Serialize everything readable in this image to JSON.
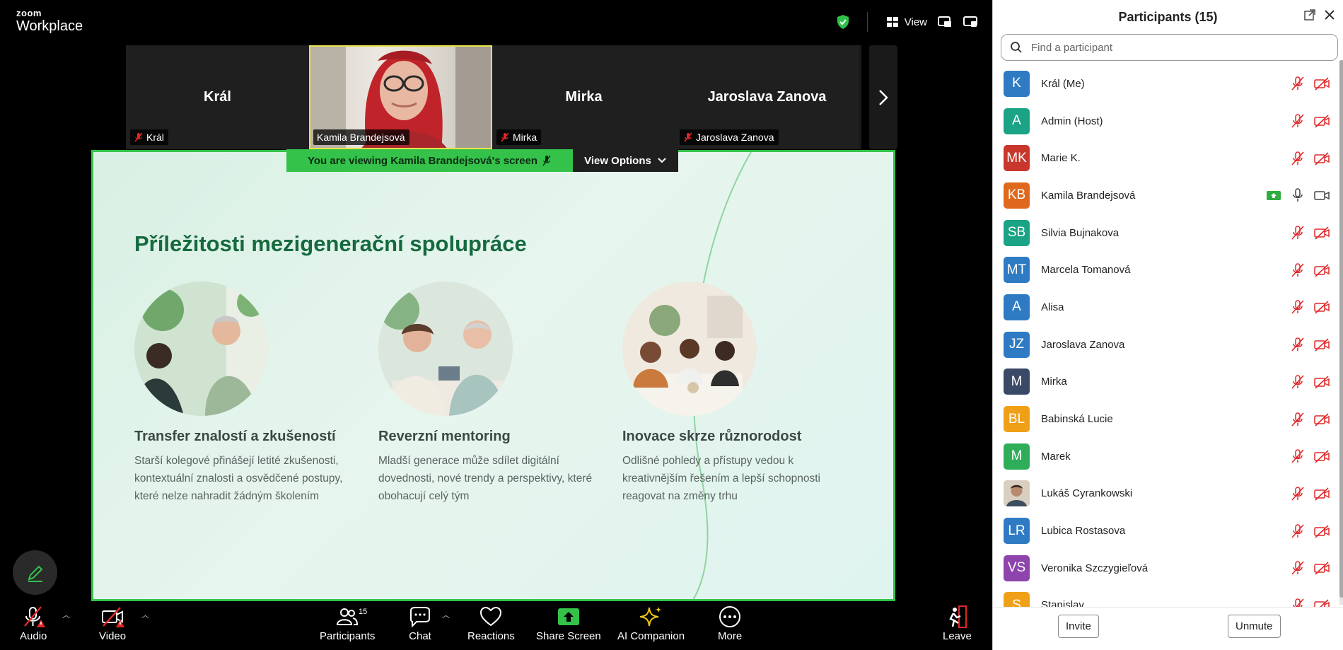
{
  "app": {
    "logo_top": "zoom",
    "logo_bottom": "Workplace",
    "view_label": "View"
  },
  "strip": {
    "tiles": [
      {
        "name": "Král",
        "tag": "Král"
      },
      {
        "name": "",
        "tag": "Kamila Brandejsová"
      },
      {
        "name": "Mirka",
        "tag": "Mirka"
      },
      {
        "name": "Jaroslava Zanova",
        "tag": "Jaroslava Zanova"
      }
    ]
  },
  "share": {
    "banner_text": "You are viewing  Kamila Brandejsová's screen",
    "view_options": "View Options",
    "slide_title": "Příležitosti mezigenerační spolupráce",
    "columns": [
      {
        "heading": "Transfer znalostí a zkušeností",
        "text": "Starší kolegové přinášejí letité zkušenosti, kontextuální znalosti a osvědčené postupy, které nelze nahradit žádným školením"
      },
      {
        "heading": "Reverzní mentoring",
        "text": "Mladší generace může sdílet digitální dovednosti, nové trendy a perspektivy, které obohacují celý tým"
      },
      {
        "heading": "Inovace skrze různorodost",
        "text": "Odlišné pohledy a přístupy vedou k kreativnějším řešením a lepší schopnosti reagovat na změny trhu"
      }
    ]
  },
  "toolbar": {
    "audio": "Audio",
    "video": "Video",
    "participants": "Participants",
    "participants_count": "15",
    "chat": "Chat",
    "reactions": "Reactions",
    "share_screen": "Share Screen",
    "ai_companion": "AI Companion",
    "more": "More",
    "leave": "Leave"
  },
  "panel": {
    "title": "Participants (15)",
    "search_placeholder": "Find a participant",
    "participants": [
      {
        "initials": "K",
        "name": "Král (Me)",
        "color": "#2e7bc4"
      },
      {
        "initials": "A",
        "name": "Admin (Host)",
        "color": "#1aa384"
      },
      {
        "initials": "MK",
        "name": "Marie K.",
        "color": "#c9372c"
      },
      {
        "initials": "KB",
        "name": "Kamila Brandejsová",
        "color": "#e0681d"
      },
      {
        "initials": "SB",
        "name": "Silvia Bujnakova",
        "color": "#1aa384"
      },
      {
        "initials": "MT",
        "name": "Marcela Tomanová",
        "color": "#2e7bc4"
      },
      {
        "initials": "A",
        "name": "Alisa",
        "color": "#2e7bc4"
      },
      {
        "initials": "JZ",
        "name": "Jaroslava Zanova",
        "color": "#2e7bc4"
      },
      {
        "initials": "M",
        "name": "Mirka",
        "color": "#3a4a66"
      },
      {
        "initials": "BL",
        "name": "Babinská Lucie",
        "color": "#f0a017"
      },
      {
        "initials": "M",
        "name": "Marek",
        "color": "#2fae5a"
      },
      {
        "initials": "",
        "name": "Lukáš Cyrankowski",
        "color": "#c9b8a4"
      },
      {
        "initials": "LR",
        "name": "Lubica Rostasova",
        "color": "#2e7bc4"
      },
      {
        "initials": "VS",
        "name": "Veronika Szczygieľová",
        "color": "#8e44ad"
      },
      {
        "initials": "S",
        "name": "Stanislav",
        "color": "#f0a017"
      }
    ],
    "invite": "Invite",
    "unmute": "Unmute"
  },
  "colors": {
    "accent_green": "#35c24a",
    "muted_red": "#e02828",
    "title_green": "#156a3e"
  }
}
